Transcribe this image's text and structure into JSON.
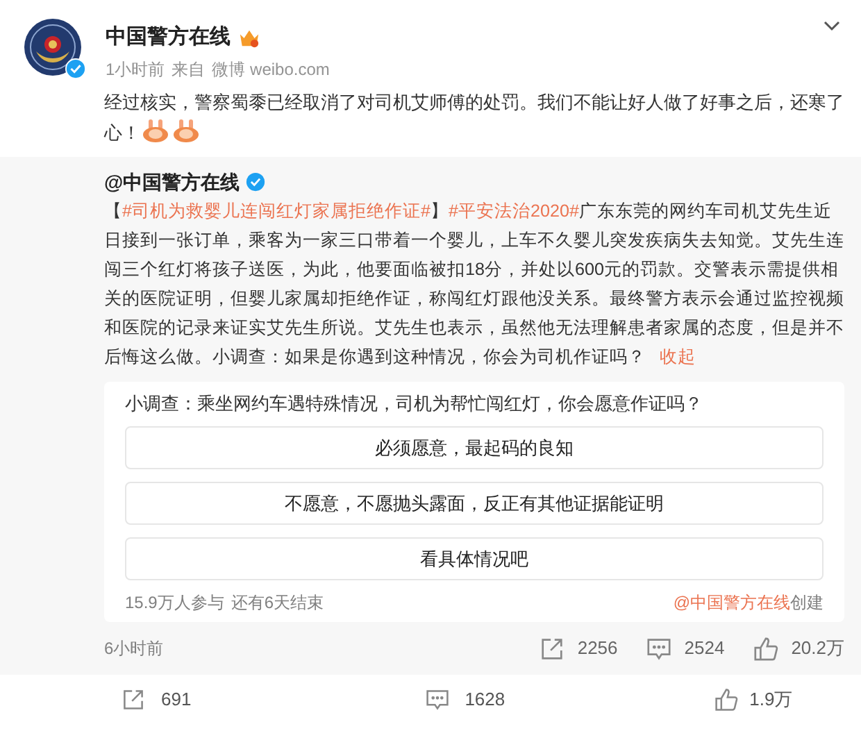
{
  "post": {
    "author": "中国警方在线",
    "time": "1小时前",
    "source_prefix": "来自",
    "source": "微博 weibo.com",
    "text": "经过核实，警察蜀黍已经取消了对司机艾师傅的处罚。我们不能让好人做了好事之后，还寒了心！"
  },
  "repost": {
    "author": "@中国警方在线",
    "segments": [
      {
        "kind": "text",
        "text": "【"
      },
      {
        "kind": "link",
        "text": "#司机为救婴儿连闯红灯家属拒绝作证#"
      },
      {
        "kind": "text",
        "text": "】"
      },
      {
        "kind": "link",
        "text": "#平安法治2020#"
      },
      {
        "kind": "text",
        "text": "广东东莞的网约车司机艾先生近日接到一张订单，乘客为一家三口带着一个婴儿，上车不久婴儿突发疾病失去知觉。艾先生连闯三个红灯将孩子送医，为此，他要面临被扣18分，并处以600元的罚款。交警表示需提供相关的医院证明，但婴儿家属却拒绝作证，称闯红灯跟他没关系。最终警方表示会通过监控视频和医院的记录来证实艾先生所说。艾先生也表示，虽然他无法理解患者家属的态度，但是并不后悔这么做。小调查：如果是你遇到这种情况，你会为司机作证吗？"
      },
      {
        "kind": "link",
        "text": "收起"
      }
    ],
    "poll": {
      "question": "小调查：乘坐网约车遇特殊情况，司机为帮忙闯红灯，你会愿意作证吗？",
      "options": [
        "必须愿意，最起码的良知",
        "不愿意，不愿抛头露面，反正有其他证据能证明",
        "看具体情况吧"
      ],
      "participants": "15.9万人参与",
      "remaining": "还有6天结束",
      "creator": "@中国警方在线",
      "created": "创建"
    },
    "time": "6小时前",
    "reposts": "2256",
    "comments": "2524",
    "likes": "20.2万"
  },
  "actions": {
    "reposts": "691",
    "comments": "1628",
    "likes": "1.9万"
  }
}
